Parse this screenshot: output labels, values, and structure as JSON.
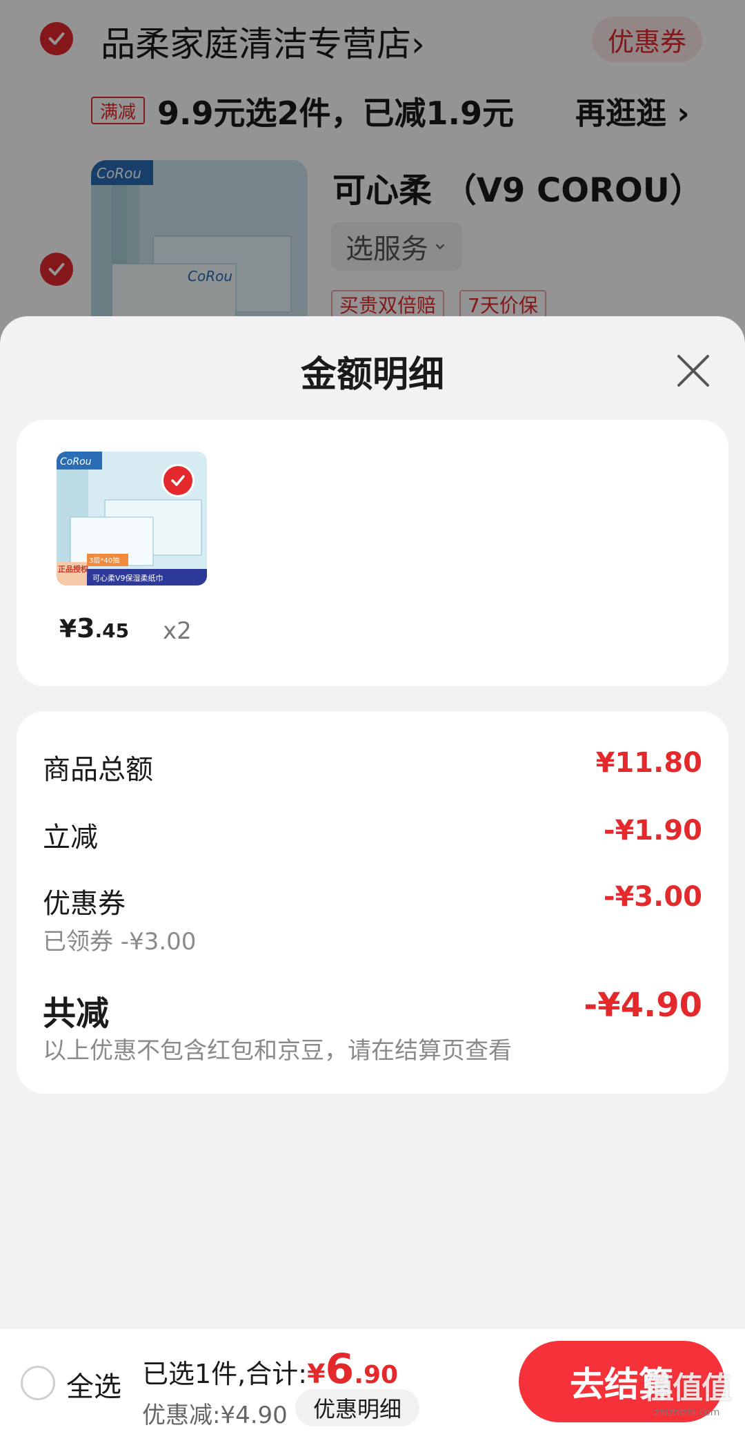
{
  "background_cart": {
    "shop_name": "品柔家庭清洁专营店",
    "shop_arrow": "›",
    "coupon_label": "优惠券",
    "promo_tag": "满减",
    "promo_text": "9.9元选2件，已减1.9元",
    "promo_link": "再逛逛 ›",
    "product_title": "可心柔 （V9 COROU）",
    "service_label": "选服务",
    "guarantee_tags": [
      "买贵双倍赔",
      "7天价保"
    ],
    "brand_logo": "CoRou"
  },
  "sheet": {
    "title": "金额明细",
    "items": [
      {
        "price_symbol": "¥",
        "price_int": "3",
        "price_dec": ".45",
        "qty": "x2",
        "brand_logo": "CoRou",
        "badge": "正品授权",
        "banner": "可心柔V9保湿柔纸巾",
        "pack_label": "3层*40抽"
      }
    ],
    "summary": {
      "goods_total_label": "商品总额",
      "goods_total_value": "¥11.80",
      "instant_discount_label": "立减",
      "instant_discount_value": "-¥1.90",
      "coupon_label": "优惠券",
      "coupon_value": "-¥3.00",
      "coupon_note": "已领券 -¥3.00",
      "total_discount_label": "共减",
      "total_discount_value": "-¥4.90",
      "total_discount_note": "以上优惠不包含红包和京豆，请在结算页查看"
    }
  },
  "bottom_bar": {
    "select_all_label": "全选",
    "selected_text": "已选1件,合计:",
    "total_symbol": "¥",
    "total_int": "6",
    "total_dec": ".90",
    "discount_text": "优惠减:¥4.90",
    "detail_label": "优惠明细",
    "checkout_label": "去结算",
    "watermark": "值值值",
    "watermark_sub": "zhizhizhi.com"
  },
  "colors": {
    "accent": "#e4292c",
    "checkout": "#f5323a",
    "sheet_bg": "#f2f2f4"
  }
}
